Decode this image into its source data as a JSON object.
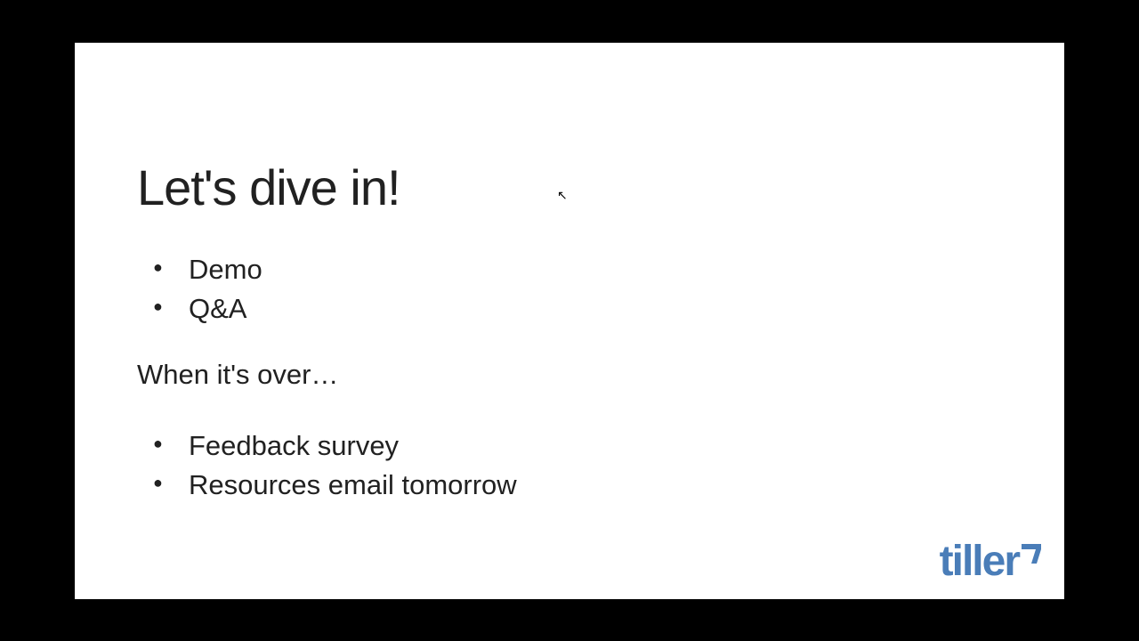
{
  "slide": {
    "title": "Let's dive in!",
    "bullets_top": [
      "Demo",
      "Q&A"
    ],
    "subheading": "When it's over…",
    "bullets_bottom": [
      "Feedback survey",
      "Resources email tomorrow"
    ]
  },
  "brand": {
    "name": "tiller",
    "color": "#4a7db8"
  }
}
